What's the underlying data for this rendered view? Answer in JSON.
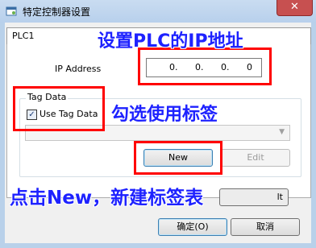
{
  "window": {
    "title": "特定控制器设置",
    "close_glyph": "✕",
    "tab_label": "PLC1"
  },
  "ip": {
    "label": "IP Address",
    "octets": [
      "0.",
      "0.",
      "0.",
      "0"
    ]
  },
  "tag_data": {
    "group_label": "Tag Data",
    "checkbox_label": "Use Tag Data",
    "checked": true,
    "check_glyph": "✓",
    "combo_value": "",
    "combo_arrow": "▼",
    "new_label": "New",
    "edit_label": "Edit"
  },
  "default_button_label": "lt",
  "buttons": {
    "ok": "确定(O)",
    "cancel": "取消"
  },
  "annotations": {
    "ip": "设置PLC的IP地址",
    "tag": "勾选使用标签",
    "new": "点击New，新建标签表"
  },
  "colors": {
    "annotation_text": "#1e22ff",
    "highlight_box": "#ff0000",
    "title_bar": "#c9dcf1",
    "close_button": "#c75050"
  }
}
